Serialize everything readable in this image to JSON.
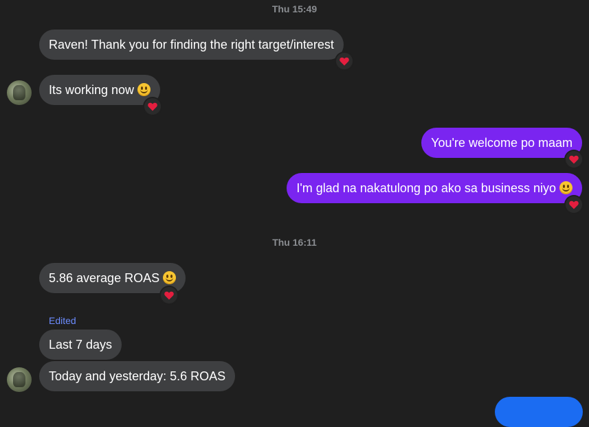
{
  "timestamps": {
    "first": "Thu 15:49",
    "second": "Thu 16:11"
  },
  "messages": {
    "m1": "Raven! Thank you for finding the right target/interest",
    "m2": "Its working now",
    "m3": "You're welcome po maam",
    "m4": "I'm glad na nakatulong po ako sa business niyo",
    "m5": "5.86 average ROAS",
    "m6": "Last 7 days",
    "m7": "Today and yesterday: 5.6 ROAS"
  },
  "edited_label": "Edited",
  "icons": {
    "reaction": "heart-icon",
    "emoji": "smiling-face-emoji",
    "avatar": "contact-avatar"
  },
  "colors": {
    "background": "#1f1f1f",
    "incoming_bubble": "#3e3f41",
    "outgoing_bubble": "#7a25f0",
    "heart": "#e41e3f",
    "edited": "#6c8cff",
    "partial_bubble": "#1b6cf2"
  }
}
